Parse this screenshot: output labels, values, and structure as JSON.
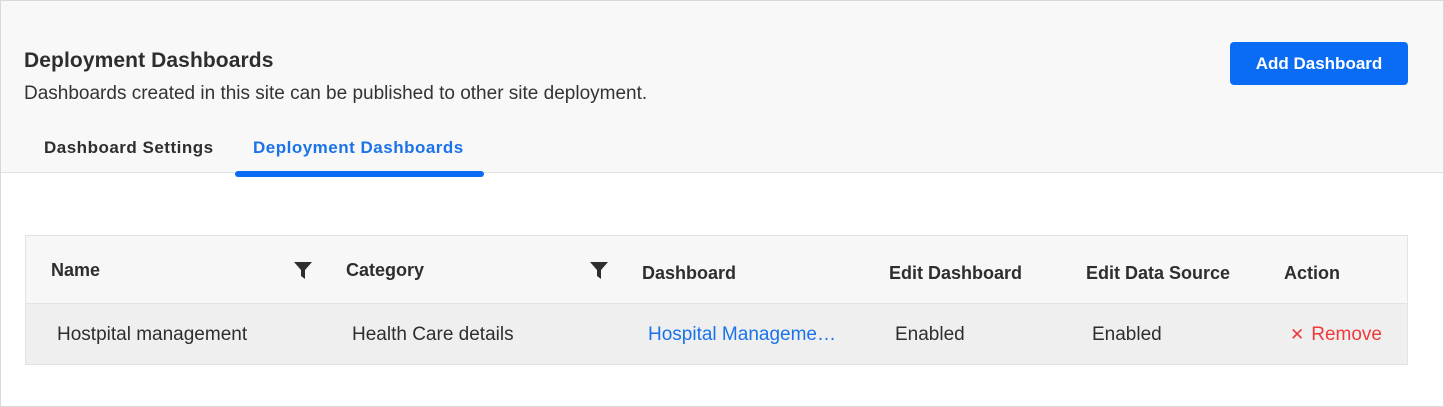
{
  "header": {
    "title": "Deployment Dashboards",
    "subtitle": "Dashboards created in this site can be published to other site deployment.",
    "add_button_label": "Add Dashboard"
  },
  "tabs": [
    {
      "label": "Dashboard Settings",
      "active": false
    },
    {
      "label": "Deployment Dashboards",
      "active": true
    }
  ],
  "table": {
    "columns": [
      "Name",
      "Category",
      "Dashboard",
      "Edit Dashboard",
      "Edit Data Source",
      "Action"
    ],
    "rows": [
      {
        "name": "Hostpital management",
        "category": "Health Care details",
        "dashboard": "Hospital Manageme…",
        "edit_dashboard": "Enabled",
        "edit_data_source": "Enabled",
        "action": "Remove"
      }
    ]
  },
  "icons": {
    "filter": "filter-icon",
    "remove": "close-icon"
  },
  "colors": {
    "accent": "#0a6cf5",
    "link": "#1a73e8",
    "danger": "#ee3a3a"
  }
}
